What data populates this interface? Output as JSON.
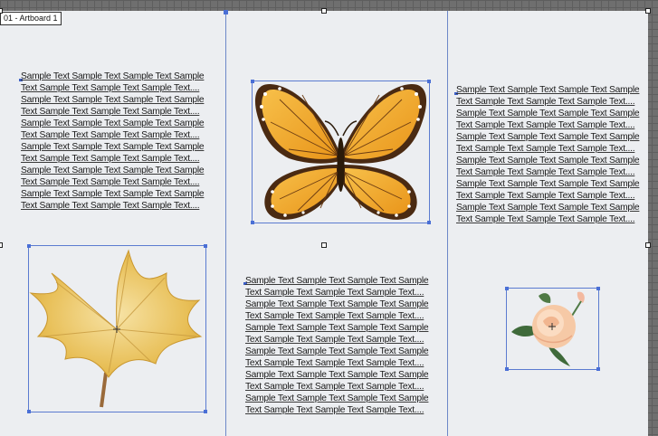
{
  "artboard": {
    "label": "01 - Artboard 1"
  },
  "panels": {
    "left_text": [
      "Sample Text Sample Text Sample Text Sample",
      "Text Sample Text Sample Text Sample Text....",
      "Sample Text Sample Text Sample Text Sample",
      "Text Sample Text Sample Text Sample Text....",
      "Sample Text Sample Text Sample Text Sample",
      "Text Sample Text Sample Text Sample Text....",
      "Sample Text Sample Text Sample Text Sample",
      "Text Sample Text Sample Text Sample Text....",
      "Sample Text Sample Text Sample Text Sample",
      "Text Sample Text Sample Text Sample Text....",
      "Sample Text Sample Text Sample Text Sample",
      "Text Sample Text Sample Text Sample Text...."
    ],
    "center_text": [
      "Sample Text Sample Text Sample Text Sample",
      "Text Sample Text Sample Text Sample Text....",
      "Sample Text Sample Text Sample Text Sample",
      "Text Sample Text Sample Text Sample Text....",
      "Sample Text Sample Text Sample Text Sample",
      "Text Sample Text Sample Text Sample Text....",
      "Sample Text Sample Text Sample Text Sample",
      "Text Sample Text Sample Text Sample Text....",
      "Sample Text Sample Text Sample Text Sample",
      "Text Sample Text Sample Text Sample Text....",
      "Sample Text Sample Text Sample Text Sample",
      "Text Sample Text Sample Text Sample Text...."
    ],
    "right_text": [
      "Sample Text Sample Text Sample Text Sample",
      "Text Sample Text Sample Text Sample Text....",
      "Sample Text Sample Text Sample Text Sample",
      "Text Sample Text Sample Text Sample Text....",
      "Sample Text Sample Text Sample Text Sample",
      "Text Sample Text Sample Text Sample Text....",
      "Sample Text Sample Text Sample Text Sample",
      "Text Sample Text Sample Text Sample Text....",
      "Sample Text Sample Text Sample Text Sample",
      "Text Sample Text Sample Text Sample Text....",
      "Sample Text Sample Text Sample Text Sample",
      "Text Sample Text Sample Text Sample Text...."
    ]
  },
  "images": {
    "butterfly": "butterfly-image",
    "leaf": "maple-leaf-image",
    "rose": "rose-image"
  },
  "colors": {
    "canvas": "#6f6f6f",
    "artboard": "#eceef1",
    "selection": "#5b7bd0",
    "butterfly_wing": "#f0a820",
    "butterfly_border": "#4a2a12",
    "leaf": "#e8bf57",
    "rose": "#f6c9a6"
  }
}
